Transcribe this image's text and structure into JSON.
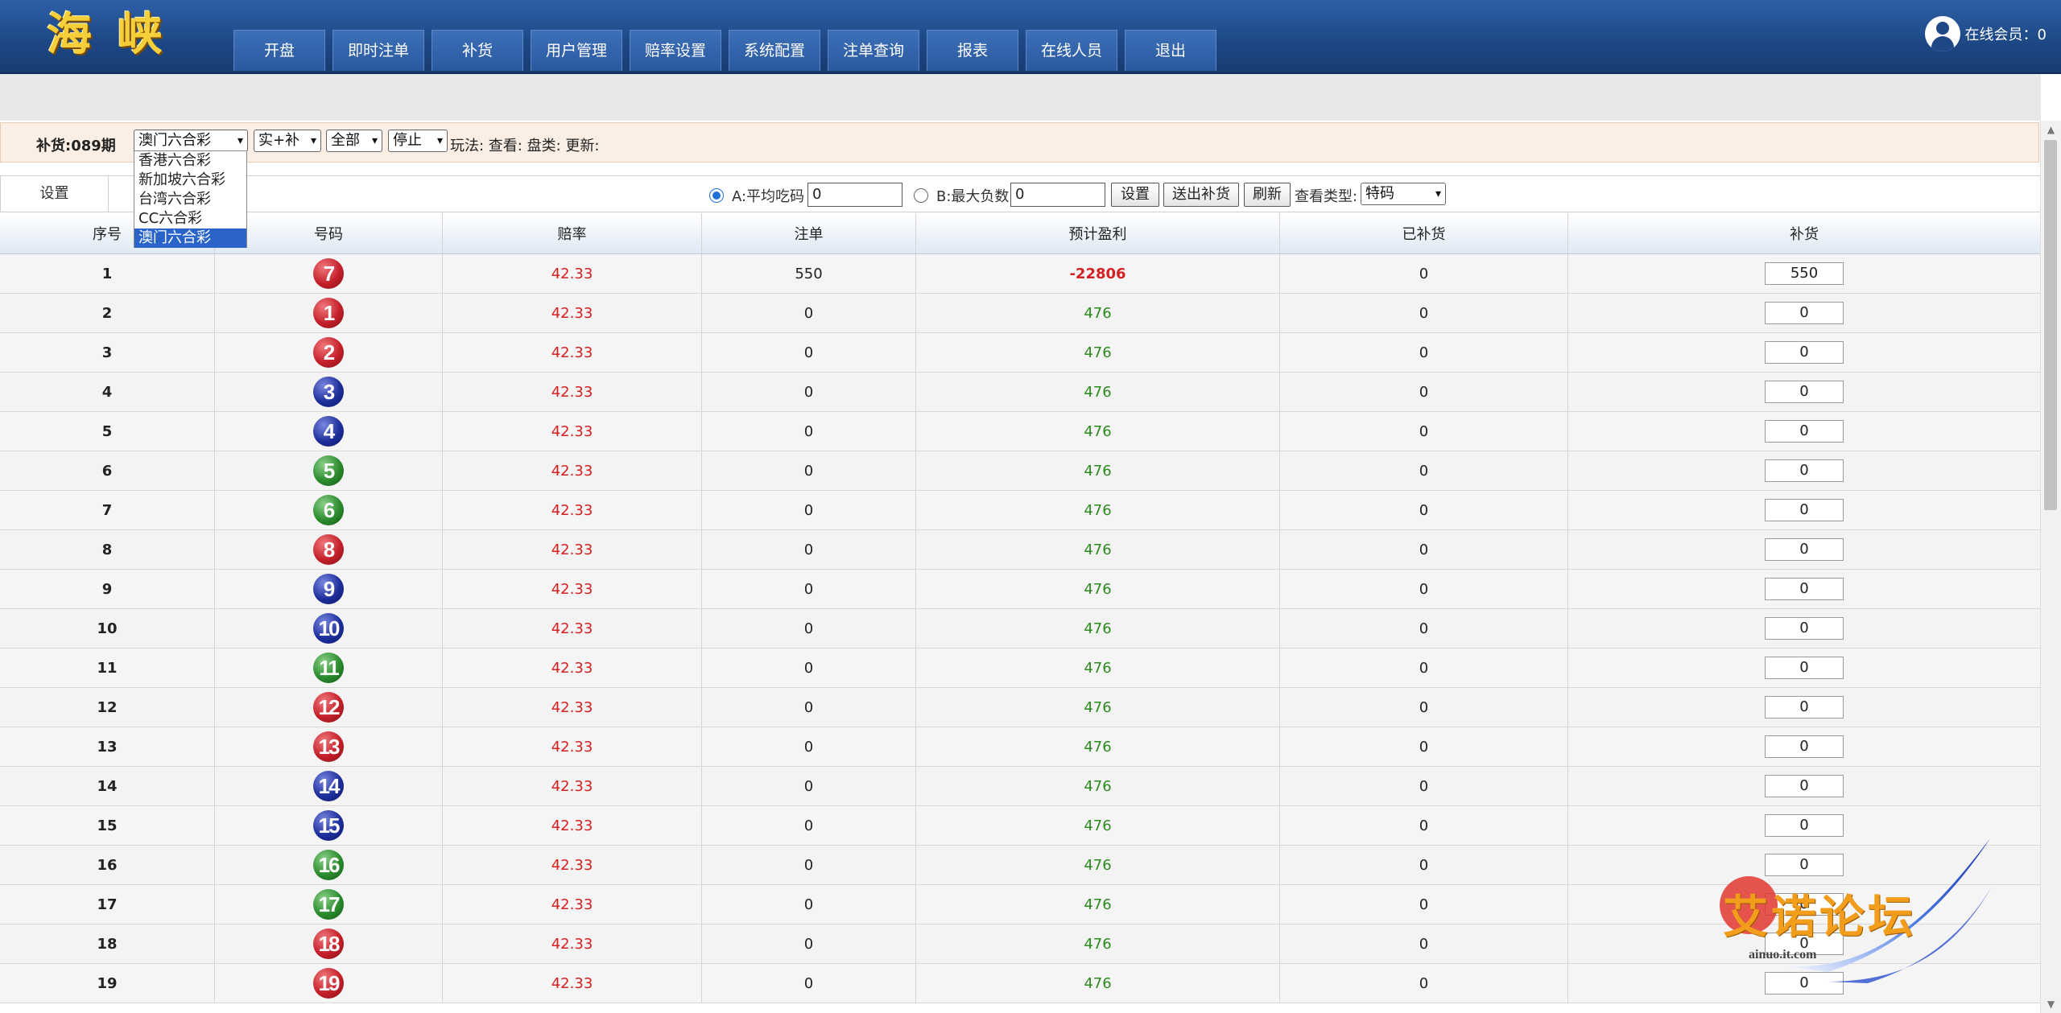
{
  "header": {
    "logo_text": "海 峡",
    "nav": [
      "开盘",
      "即时注单",
      "补货",
      "用户管理",
      "赔率设置",
      "系统配置",
      "注单查询",
      "报表",
      "在线人员",
      "退出"
    ],
    "online_label": "在线会员：0"
  },
  "filter": {
    "title": "补货:089期",
    "lottery_selected": "澳门六合彩",
    "lottery_options": [
      "香港六合彩",
      "新加坡六合彩",
      "台湾六合彩",
      "CC六合彩",
      "澳门六合彩"
    ],
    "mode_selected": "实+补",
    "scope_selected": "全部",
    "status_selected": "停止",
    "info_text": "玩法: 查看: 盘类: 更新:"
  },
  "settings": {
    "label": "设置",
    "option_a_label": "A:平均吃码",
    "option_a_value": "0",
    "option_b_label": "B:最大负数",
    "option_b_value": "0",
    "set_button": "设置",
    "send_button": "送出补货",
    "refresh_button": "刷新",
    "view_type_label": "查看类型:",
    "view_type_selected": "特码"
  },
  "table": {
    "headers": [
      "序号",
      "号码",
      "赔率",
      "注单",
      "预计盈利",
      "已补货",
      "补货"
    ],
    "rows": [
      {
        "idx": "1",
        "ball": "7",
        "color": "red",
        "odds": "42.33",
        "bets": "550",
        "profit": "-22806",
        "done": "0",
        "fill": "550"
      },
      {
        "idx": "2",
        "ball": "1",
        "color": "red",
        "odds": "42.33",
        "bets": "0",
        "profit": "476",
        "done": "0",
        "fill": "0"
      },
      {
        "idx": "3",
        "ball": "2",
        "color": "red",
        "odds": "42.33",
        "bets": "0",
        "profit": "476",
        "done": "0",
        "fill": "0"
      },
      {
        "idx": "4",
        "ball": "3",
        "color": "blue",
        "odds": "42.33",
        "bets": "0",
        "profit": "476",
        "done": "0",
        "fill": "0"
      },
      {
        "idx": "5",
        "ball": "4",
        "color": "blue",
        "odds": "42.33",
        "bets": "0",
        "profit": "476",
        "done": "0",
        "fill": "0"
      },
      {
        "idx": "6",
        "ball": "5",
        "color": "green",
        "odds": "42.33",
        "bets": "0",
        "profit": "476",
        "done": "0",
        "fill": "0"
      },
      {
        "idx": "7",
        "ball": "6",
        "color": "green",
        "odds": "42.33",
        "bets": "0",
        "profit": "476",
        "done": "0",
        "fill": "0"
      },
      {
        "idx": "8",
        "ball": "8",
        "color": "red",
        "odds": "42.33",
        "bets": "0",
        "profit": "476",
        "done": "0",
        "fill": "0"
      },
      {
        "idx": "9",
        "ball": "9",
        "color": "blue",
        "odds": "42.33",
        "bets": "0",
        "profit": "476",
        "done": "0",
        "fill": "0"
      },
      {
        "idx": "10",
        "ball": "10",
        "color": "blue",
        "odds": "42.33",
        "bets": "0",
        "profit": "476",
        "done": "0",
        "fill": "0"
      },
      {
        "idx": "11",
        "ball": "11",
        "color": "green",
        "odds": "42.33",
        "bets": "0",
        "profit": "476",
        "done": "0",
        "fill": "0"
      },
      {
        "idx": "12",
        "ball": "12",
        "color": "red",
        "odds": "42.33",
        "bets": "0",
        "profit": "476",
        "done": "0",
        "fill": "0"
      },
      {
        "idx": "13",
        "ball": "13",
        "color": "red",
        "odds": "42.33",
        "bets": "0",
        "profit": "476",
        "done": "0",
        "fill": "0"
      },
      {
        "idx": "14",
        "ball": "14",
        "color": "blue",
        "odds": "42.33",
        "bets": "0",
        "profit": "476",
        "done": "0",
        "fill": "0"
      },
      {
        "idx": "15",
        "ball": "15",
        "color": "blue",
        "odds": "42.33",
        "bets": "0",
        "profit": "476",
        "done": "0",
        "fill": "0"
      },
      {
        "idx": "16",
        "ball": "16",
        "color": "green",
        "odds": "42.33",
        "bets": "0",
        "profit": "476",
        "done": "0",
        "fill": "0"
      },
      {
        "idx": "17",
        "ball": "17",
        "color": "green",
        "odds": "42.33",
        "bets": "0",
        "profit": "476",
        "done": "0",
        "fill": "0"
      },
      {
        "idx": "18",
        "ball": "18",
        "color": "red",
        "odds": "42.33",
        "bets": "0",
        "profit": "476",
        "done": "0",
        "fill": "0"
      },
      {
        "idx": "19",
        "ball": "19",
        "color": "red",
        "odds": "42.33",
        "bets": "0",
        "profit": "476",
        "done": "0",
        "fill": "0"
      }
    ]
  },
  "watermark": {
    "text": "艾诺论坛",
    "url": "ainuo.it.com"
  }
}
